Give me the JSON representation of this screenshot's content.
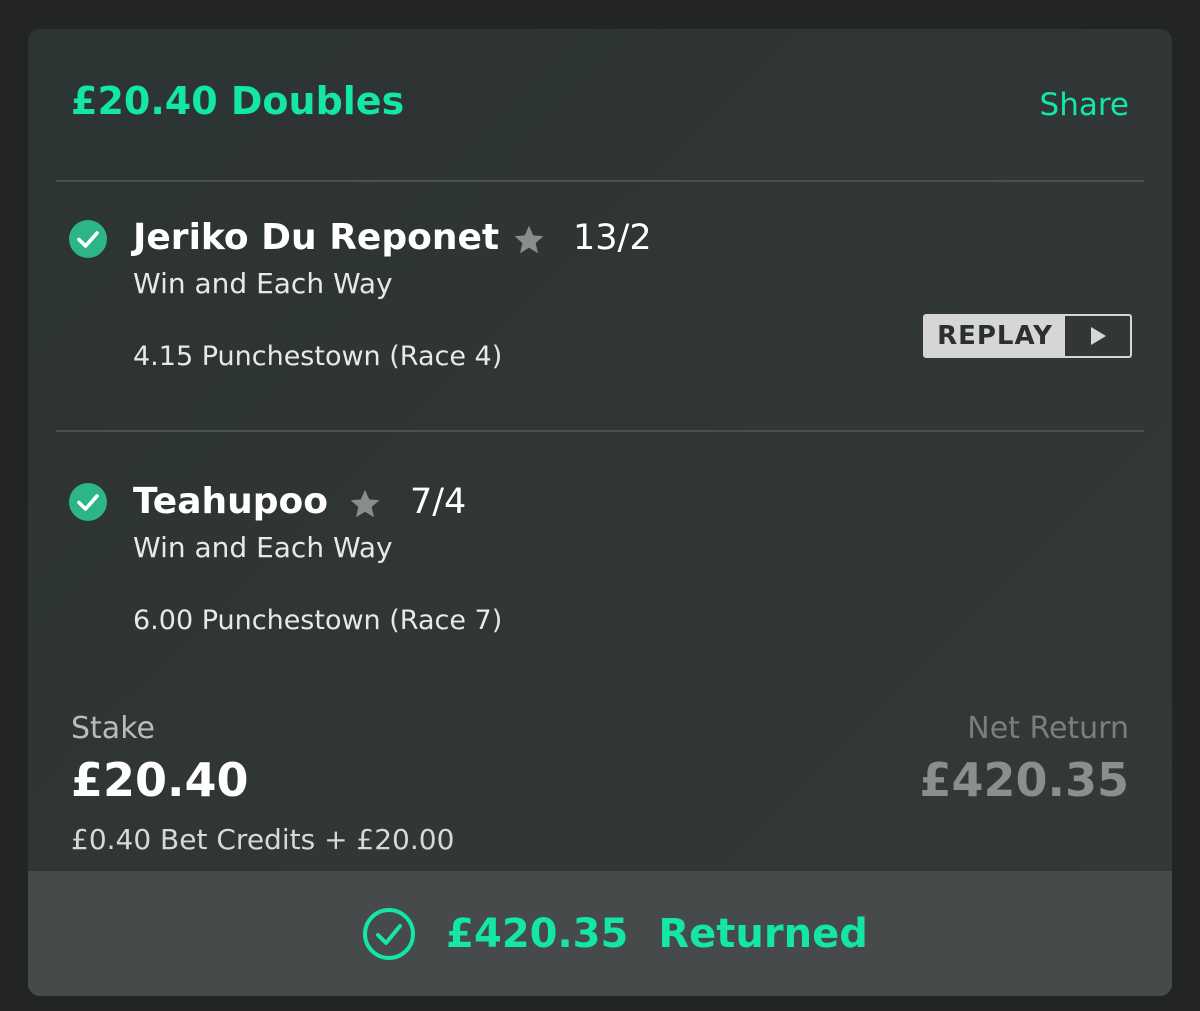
{
  "header": {
    "title": "£20.40 Doubles",
    "share_label": "Share"
  },
  "selections": [
    {
      "name": "Jeriko Du Reponet",
      "odds": "13/2",
      "market": "Win and Each Way",
      "event": "4.15 Punchestown (Race 4)",
      "status": "won",
      "replay_label": "REPLAY"
    },
    {
      "name": "Teahupoo",
      "odds": "7/4",
      "market": "Win and Each Way",
      "event": "6.00 Punchestown (Race 7)",
      "status": "won"
    }
  ],
  "stake": {
    "label": "Stake",
    "value": "£20.40",
    "detail": "£0.40 Bet Credits + £20.00"
  },
  "net_return": {
    "label": "Net Return",
    "value": "£420.35"
  },
  "footer": {
    "amount": "£420.35",
    "status": "Returned"
  },
  "icons": {
    "selection_status": "check-circle-icon",
    "favourite": "star-icon",
    "replay": "play-icon",
    "footer_status": "check-circle-outline-icon"
  },
  "colors": {
    "accent": "#14e6a4",
    "check_fill": "#2db58a",
    "background": "#232425",
    "card": "#303535",
    "footer": "#474a4a"
  }
}
